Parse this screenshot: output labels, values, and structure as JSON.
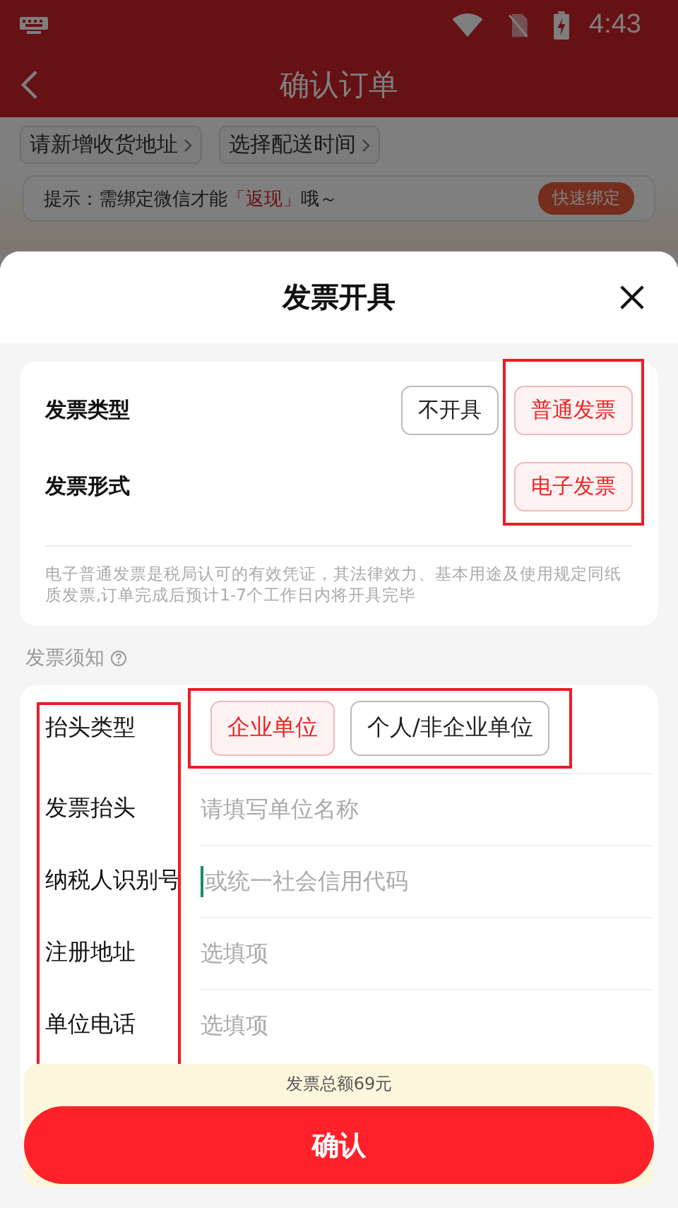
{
  "status_bar": {
    "time": "4:43"
  },
  "header": {
    "title": "确认订单"
  },
  "chips": [
    {
      "label": "请新增收货地址"
    },
    {
      "label": "选择配送时间"
    }
  ],
  "tip": {
    "prefix": "提示：需绑定微信才能",
    "highlight": "「返现」",
    "suffix": "哦～",
    "button": "快速绑定"
  },
  "sheet": {
    "title": "发票开具"
  },
  "invoice_settings": {
    "options_highlighted": true,
    "rows": [
      {
        "label": "发票类型",
        "options": [
          {
            "label": "不开具",
            "selected": false
          },
          {
            "label": "普通发票",
            "selected": true
          }
        ]
      },
      {
        "label": "发票形式",
        "options": [
          {
            "label": "电子发票",
            "selected": true
          }
        ]
      }
    ],
    "note": "电子普通发票是税局认可的有效凭证，其法律效力、基本用途及使用规定同纸质发票,订单完成后预计1-7个工作日内将开具完毕"
  },
  "notice": {
    "label": "发票须知"
  },
  "title_form": {
    "options_highlighted": true,
    "labels_highlighted": true,
    "fields": [
      {
        "kind": "choice",
        "label": "抬头类型",
        "options": [
          {
            "label": "企业单位",
            "selected": true
          },
          {
            "label": "个人/非企业单位",
            "selected": false
          }
        ]
      },
      {
        "kind": "text",
        "label": "发票抬头",
        "placeholder": "请填写单位名称",
        "focused": false
      },
      {
        "kind": "text",
        "label": "纳税人识别号",
        "placeholder": "或统一社会信用代码",
        "focused": true
      },
      {
        "kind": "text",
        "label": "注册地址",
        "placeholder": "选填项",
        "focused": false
      },
      {
        "kind": "text",
        "label": "单位电话",
        "placeholder": "选填项",
        "focused": false
      }
    ]
  },
  "footer": {
    "total": "发票总额69元",
    "confirm": "确认"
  }
}
